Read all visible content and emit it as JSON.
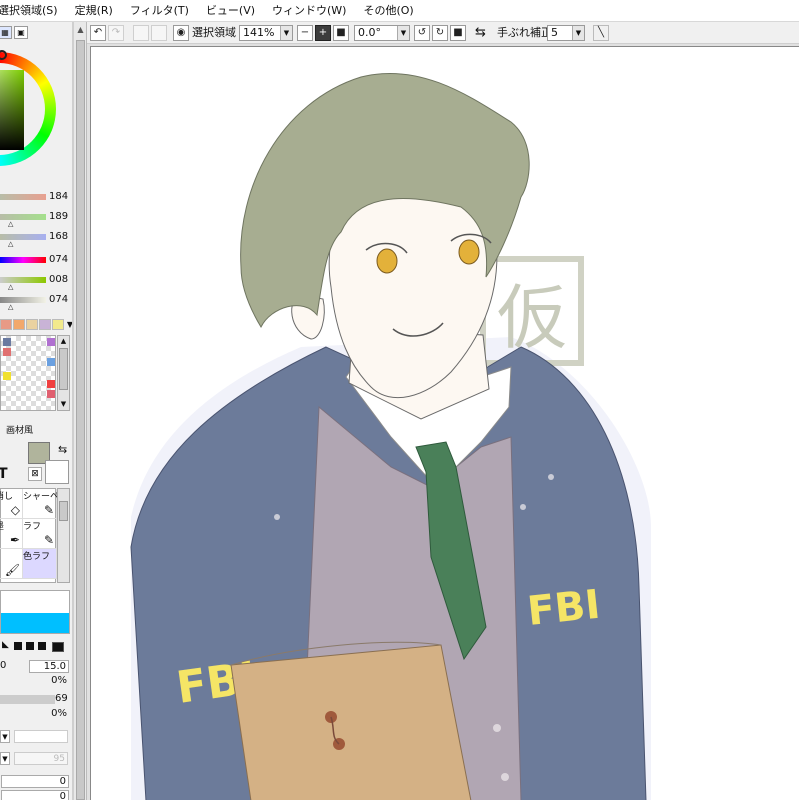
{
  "menubar": {
    "items": [
      "選択領域(S)",
      "定規(R)",
      "フィルタ(T)",
      "ビュー(V)",
      "ウィンドウ(W)",
      "その他(O)"
    ]
  },
  "toolbar": {
    "selection_label": "選択領域",
    "zoom_value": "141%",
    "rotation_value": "0.0°",
    "stabilizer_label": "手ぶれ補正",
    "stabilizer_value": "5"
  },
  "color_panel": {
    "rgb_values": [
      "184",
      "189",
      "168"
    ],
    "hsv_values": [
      "074",
      "008",
      "074"
    ],
    "fg_color": "#b0b49c",
    "bg_color": "#ffffff"
  },
  "palette": {
    "swatches": [
      "#e89a86",
      "#f2a86b",
      "#ead2a0",
      "#c9b3d6",
      "#f2ea8c"
    ]
  },
  "texture_tab_label": "画材風",
  "brushes": [
    {
      "label": "消し",
      "icon": "eraser-icon"
    },
    {
      "label": "シャーペン",
      "icon": "pencil-icon"
    },
    {
      "label": "墨",
      "icon": "ink-pen-icon"
    },
    {
      "label": "ラフ",
      "icon": "pencil-icon"
    },
    {
      "label": "",
      "icon": "brush-icon"
    },
    {
      "label": "色ラフ",
      "icon": "brush-icon"
    }
  ],
  "brush_settings": {
    "size_prefix": "0",
    "size_value": "15.0",
    "min_size_value": "0%",
    "density_value": "69",
    "texture_value": "0%",
    "extra_values": [
      "95",
      "0",
      "0"
    ]
  },
  "artwork": {
    "jacket_text_left": "FBI",
    "jacket_text_right": "FBI",
    "watermark_char": "仮"
  },
  "colors": {
    "hair": "#a7ad91",
    "skin": "#fdf8f2",
    "jacket": "#6c7b9a",
    "vest": "#b1a6b3",
    "tie": "#4a8059",
    "folder": "#d4b185",
    "fbi_text": "#f5e566",
    "eyes": "#e3b13a"
  }
}
